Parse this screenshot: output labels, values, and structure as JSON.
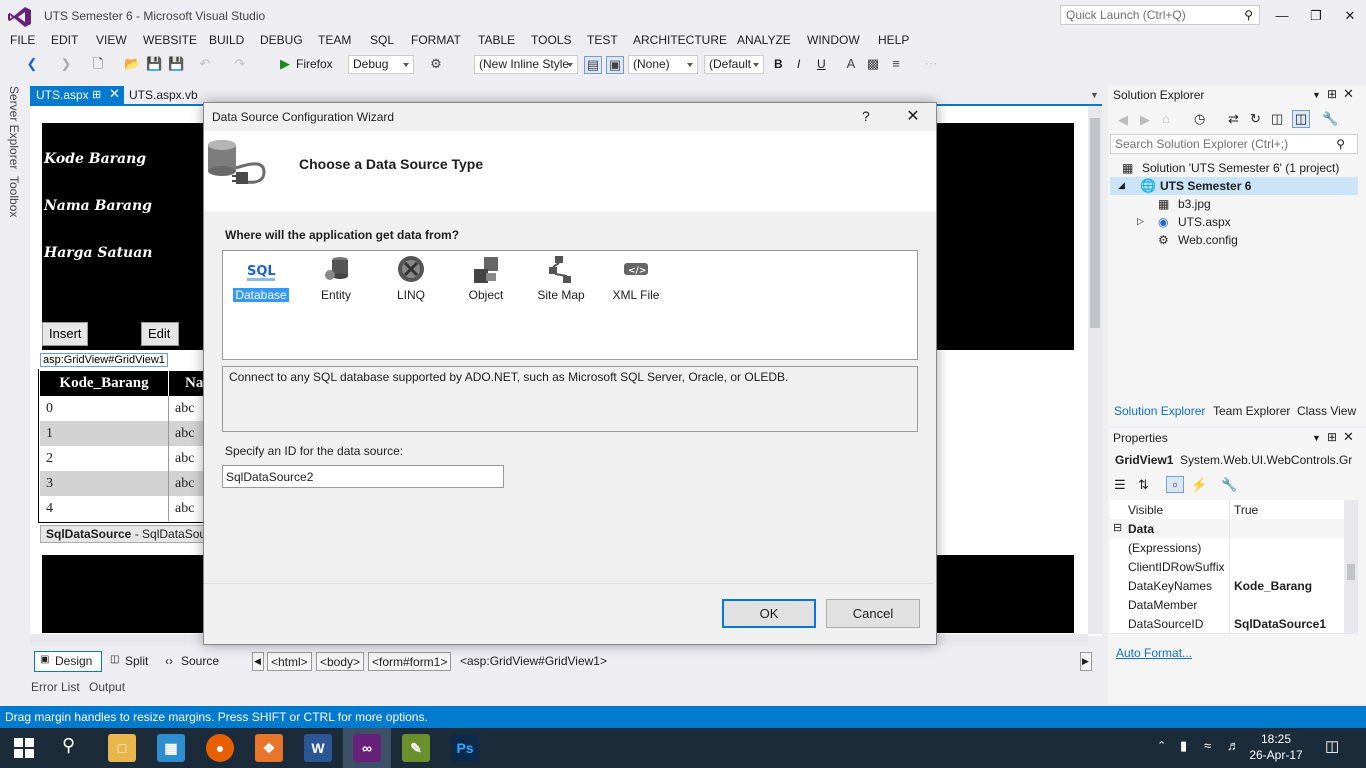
{
  "window": {
    "title": "UTS Semester 6 - Microsoft Visual Studio",
    "quick_launch_placeholder": "Quick Launch (Ctrl+Q)"
  },
  "menu": [
    "FILE",
    "EDIT",
    "VIEW",
    "WEBSITE",
    "BUILD",
    "DEBUG",
    "TEAM",
    "SQL",
    "FORMAT",
    "TABLE",
    "TOOLS",
    "TEST",
    "ARCHITECTURE",
    "ANALYZE",
    "WINDOW",
    "HELP"
  ],
  "toolbar": {
    "browser": "Firefox",
    "config": "Debug",
    "style": "(New Inline Style",
    "target": "(None)",
    "font": "(Default",
    "bold": "B",
    "italic": "I",
    "underline": "U"
  },
  "side_tabs": [
    "Server Explorer",
    "Toolbox"
  ],
  "doc_tabs": [
    "UTS.aspx",
    "UTS.aspx.vb"
  ],
  "design": {
    "labels": [
      "Kode Barang",
      "Nama Barang",
      "Harga Satuan"
    ],
    "insert_button": "Insert",
    "edit_button": "Edit",
    "gridview_tag": "asp:GridView#GridView1",
    "grid_headers": [
      "Kode_Barang",
      "Na"
    ],
    "grid_rows": [
      [
        "0",
        "abc"
      ],
      [
        "1",
        "abc"
      ],
      [
        "2",
        "abc"
      ],
      [
        "3",
        "abc"
      ],
      [
        "4",
        "abc"
      ]
    ],
    "sqldatasource_bold": "SqlDataSource",
    "sqldatasource_rest": " - SqlDataSour"
  },
  "view_bar": {
    "design": "Design",
    "split": "Split",
    "source": "Source",
    "crumbs": [
      "<html>",
      "<body>",
      "<form#form1>"
    ],
    "crumb_current": "<asp:GridView#GridView1>"
  },
  "bottom_tabs": [
    "Error List",
    "Output"
  ],
  "status": "Drag margin handles to resize margins. Press SHIFT or CTRL for more options.",
  "solution_explorer": {
    "title": "Solution Explorer",
    "search_placeholder": "Search Solution Explorer (Ctrl+;)",
    "solution": "Solution 'UTS Semester 6' (1 project)",
    "project": "UTS Semester 6",
    "files": [
      "b3.jpg",
      "UTS.aspx",
      "Web.config"
    ],
    "tabs": [
      "Solution Explorer",
      "Team Explorer",
      "Class View"
    ]
  },
  "properties": {
    "title": "Properties",
    "object": "GridView1",
    "object_type": "System.Web.UI.WebControls.Gr",
    "rows": [
      {
        "name": "Visible",
        "value": "True",
        "bold": false
      },
      {
        "name": "Data",
        "value": "",
        "category": true
      },
      {
        "name": "(Expressions)",
        "value": "",
        "bold": false
      },
      {
        "name": "ClientIDRowSuffix",
        "value": "",
        "bold": false
      },
      {
        "name": "DataKeyNames",
        "value": "Kode_Barang",
        "bold": true
      },
      {
        "name": "DataMember",
        "value": "",
        "bold": false
      },
      {
        "name": "DataSourceID",
        "value": "SqlDataSource1",
        "bold": true
      }
    ],
    "auto_format": "Auto Format..."
  },
  "dialog": {
    "title": "Data Source Configuration Wizard",
    "help": "?",
    "heading": "Choose a Data Source Type",
    "question": "Where will the application get data from?",
    "types": [
      "Database",
      "Entity",
      "LINQ",
      "Object",
      "Site Map",
      "XML File"
    ],
    "selected_type": "Database",
    "description": "Connect to any SQL database supported by ADO.NET, such as Microsoft SQL Server, Oracle, or OLEDB.",
    "id_label": "Specify an ID for the data source:",
    "id_value": "SqlDataSource2",
    "ok": "OK",
    "cancel": "Cancel"
  },
  "taskbar": {
    "time": "18:25",
    "date": "26-Apr-17"
  },
  "colors": {
    "accent": "#007acc",
    "taskbar": "#1c2b3a",
    "selection": "#3399ff"
  }
}
